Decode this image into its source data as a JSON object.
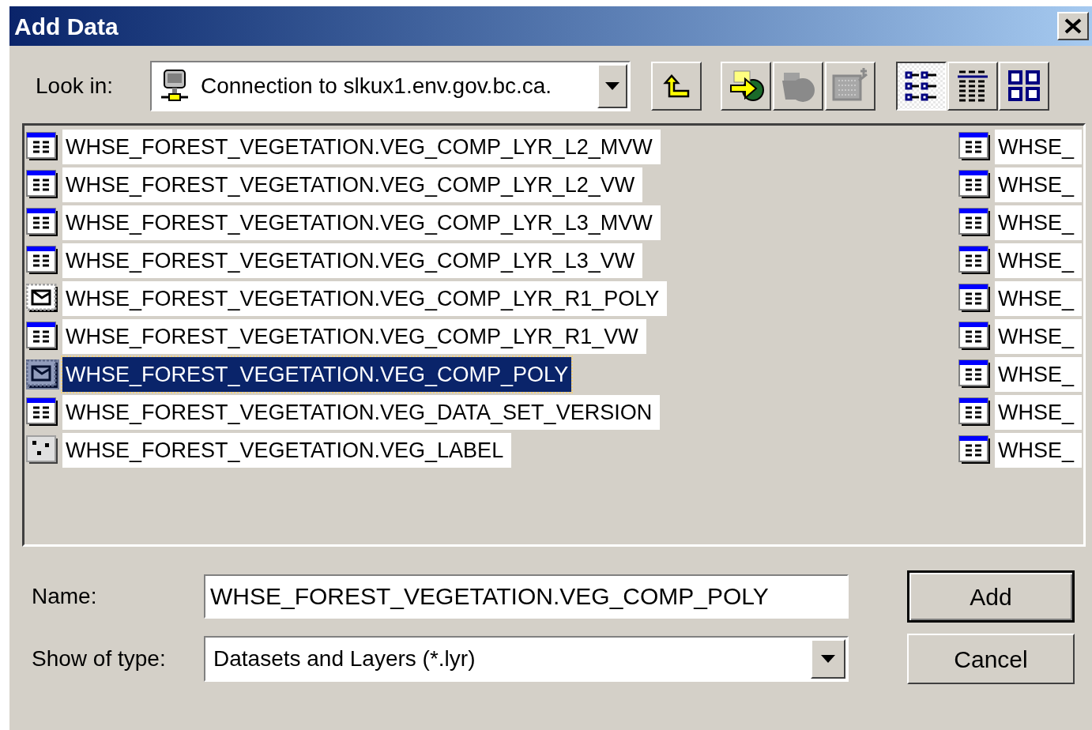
{
  "window": {
    "title": "Add Data"
  },
  "look_in": {
    "label": "Look in:",
    "value": "Connection to slkux1.env.gov.bc.ca."
  },
  "tools": [
    {
      "kind": "up",
      "disabled": false
    },
    {
      "kind": "connect",
      "disabled": false
    },
    {
      "kind": "disconnect",
      "disabled": true
    },
    {
      "kind": "properties",
      "disabled": true
    }
  ],
  "views": [
    {
      "kind": "list",
      "selected": true
    },
    {
      "kind": "details",
      "selected": false
    },
    {
      "kind": "thumbnails",
      "selected": false
    }
  ],
  "list": {
    "columns": [
      {
        "items": [
          {
            "name": "WHSE_FOREST_VEGETATION.VEG_COMP_LYR_L2_MVW",
            "kind": "table",
            "selected": false
          },
          {
            "name": "WHSE_FOREST_VEGETATION.VEG_COMP_LYR_L2_VW",
            "kind": "table",
            "selected": false
          },
          {
            "name": "WHSE_FOREST_VEGETATION.VEG_COMP_LYR_L3_MVW",
            "kind": "table",
            "selected": false
          },
          {
            "name": "WHSE_FOREST_VEGETATION.VEG_COMP_LYR_L3_VW",
            "kind": "table",
            "selected": false
          },
          {
            "name": "WHSE_FOREST_VEGETATION.VEG_COMP_LYR_R1_POLY",
            "kind": "polygon",
            "selected": false
          },
          {
            "name": "WHSE_FOREST_VEGETATION.VEG_COMP_LYR_R1_VW",
            "kind": "table",
            "selected": false
          },
          {
            "name": "WHSE_FOREST_VEGETATION.VEG_COMP_POLY",
            "kind": "polygon",
            "selected": true
          },
          {
            "name": "WHSE_FOREST_VEGETATION.VEG_DATA_SET_VERSION",
            "kind": "table",
            "selected": false
          },
          {
            "name": "WHSE_FOREST_VEGETATION.VEG_LABEL",
            "kind": "point",
            "selected": false
          }
        ]
      },
      {
        "items": [
          {
            "name": "WHSE_",
            "kind": "table",
            "selected": false
          },
          {
            "name": "WHSE_",
            "kind": "table",
            "selected": false
          },
          {
            "name": "WHSE_",
            "kind": "table",
            "selected": false
          },
          {
            "name": "WHSE_",
            "kind": "table",
            "selected": false
          },
          {
            "name": "WHSE_",
            "kind": "table",
            "selected": false
          },
          {
            "name": "WHSE_",
            "kind": "table",
            "selected": false
          },
          {
            "name": "WHSE_",
            "kind": "table",
            "selected": false
          },
          {
            "name": "WHSE_",
            "kind": "table",
            "selected": false
          },
          {
            "name": "WHSE_",
            "kind": "table",
            "selected": false
          }
        ]
      }
    ]
  },
  "name_field": {
    "label": "Name:",
    "value": "WHSE_FOREST_VEGETATION.VEG_COMP_POLY"
  },
  "type_field": {
    "label": "Show of type:",
    "value": "Datasets and Layers (*.lyr)"
  },
  "buttons": [
    {
      "label": "Add",
      "default": true
    },
    {
      "label": "Cancel",
      "default": false
    }
  ]
}
